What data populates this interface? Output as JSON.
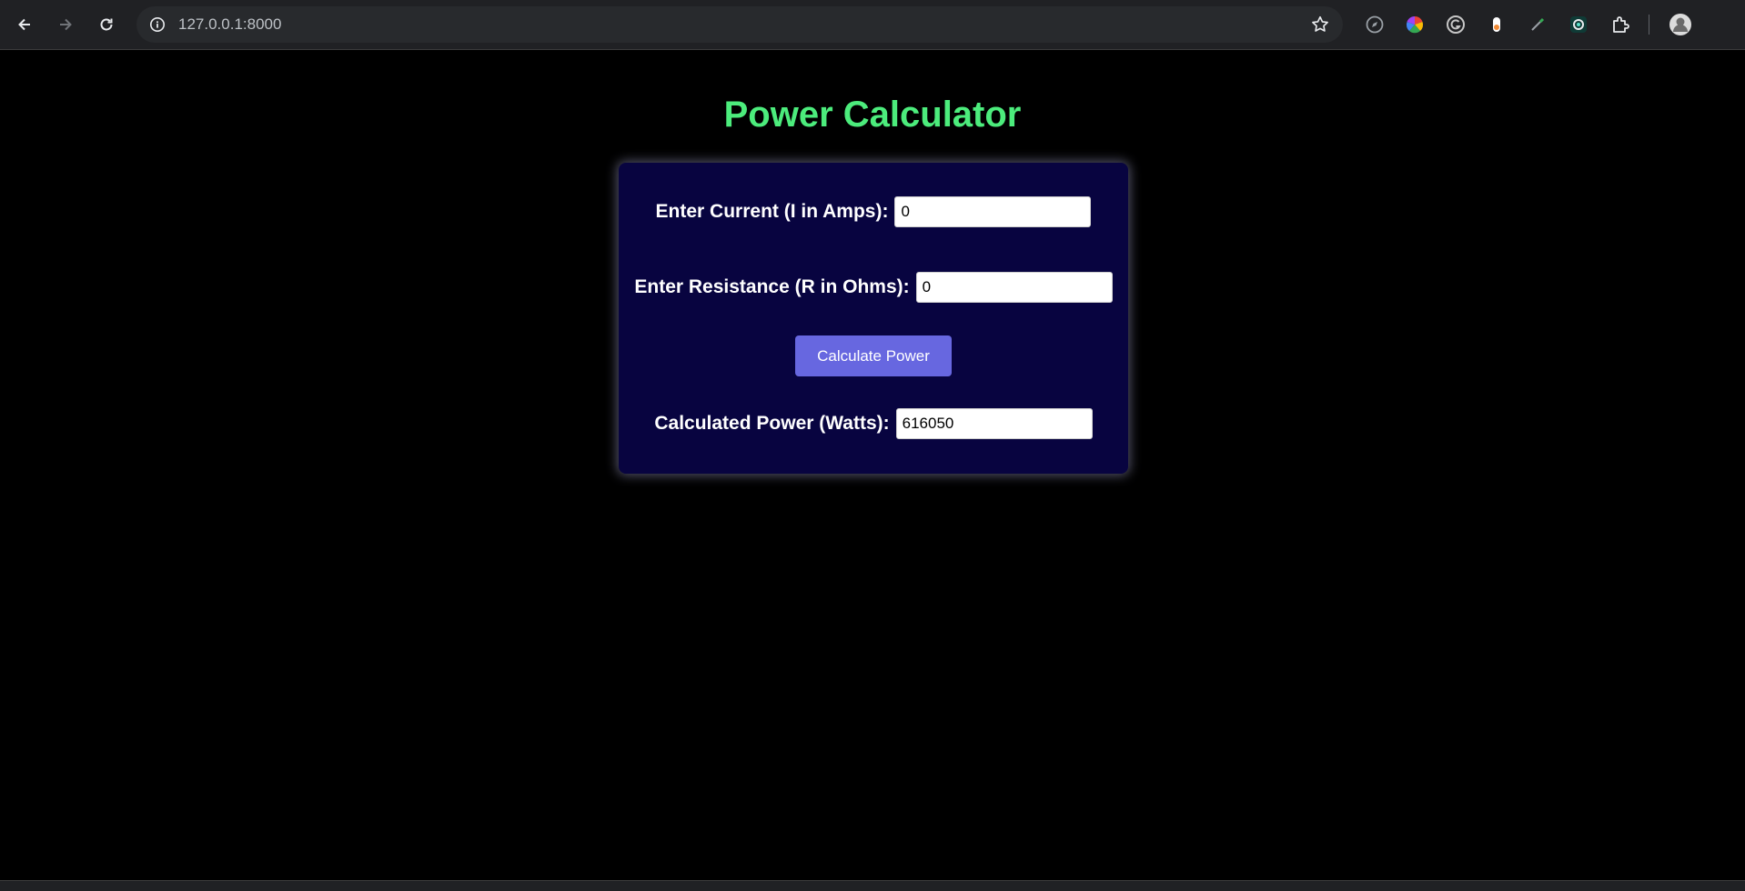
{
  "browser": {
    "url": "127.0.0.1:8000",
    "icons": {
      "back": "back-arrow-icon",
      "forward": "forward-arrow-icon",
      "reload": "reload-icon",
      "site_info": "info-icon",
      "bookmark": "star-icon",
      "extensions": [
        "compass-icon",
        "color-wheel-icon",
        "grammarly-icon",
        "gauge-icon",
        "eyedropper-icon",
        "screen-record-icon",
        "puzzle-icon"
      ],
      "profile": "avatar-icon"
    }
  },
  "page": {
    "title": "Power Calculator",
    "current_label": "Enter Current (I in Amps):",
    "current_value": "0",
    "resistance_label": "Enter Resistance (R in Ohms):",
    "resistance_value": "0",
    "button_label": "Calculate Power",
    "result_label": "Calculated Power (Watts):",
    "result_value": "616050"
  },
  "colors": {
    "background": "#000000",
    "title": "#4cec7c",
    "card": "#080440",
    "button": "#6767e0"
  }
}
